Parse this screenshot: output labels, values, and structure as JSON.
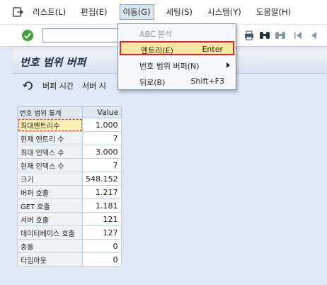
{
  "menubar": {
    "items": [
      "리스트(L)",
      "편집(E)",
      "이동(G)",
      "세팅(S)",
      "시스템(Y)",
      "도움말(H)"
    ]
  },
  "title": "번호 범위 버퍼",
  "app_toolbar": {
    "buffer_time": "버퍼 시간",
    "server_time": "서버 시"
  },
  "table": {
    "headers": [
      "번호 범위 통계",
      "Value"
    ],
    "rows": [
      {
        "label": "최대엔트리수",
        "value": "1.000"
      },
      {
        "label": "현재 엔트리 수",
        "value": "7"
      },
      {
        "label": "최대 인덱스 수",
        "value": "3.000"
      },
      {
        "label": "현재 인덱스 수",
        "value": "7"
      },
      {
        "label": "크기",
        "value": "548.152"
      },
      {
        "label": "버퍼 호출",
        "value": "1.217"
      },
      {
        "label": "GET 호출",
        "value": "1.181"
      },
      {
        "label": "서버 호출",
        "value": "121"
      },
      {
        "label": "데이터베이스 호출",
        "value": "127"
      },
      {
        "label": "충돌",
        "value": "0"
      },
      {
        "label": "타임아웃",
        "value": "0"
      }
    ]
  },
  "dropdown": {
    "items": [
      {
        "label": "ABC 분석",
        "shortcut": ""
      },
      {
        "label": "엔트리(E)",
        "shortcut": "Enter"
      },
      {
        "label": "번호 범위 버퍼(N)",
        "shortcut": ""
      },
      {
        "label": "뒤로(B)",
        "shortcut": "Shift+F3"
      }
    ]
  },
  "colors": {
    "highlight_border": "#e02323",
    "highlight_fill": "#fbe7a3",
    "ok_green": "#3aa33a"
  }
}
